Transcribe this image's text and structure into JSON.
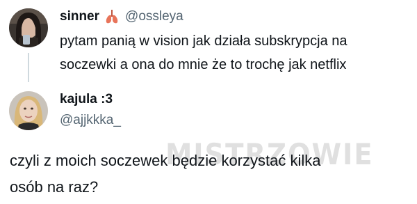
{
  "tweet1": {
    "display_name": "sinner",
    "emoji_icon": "lungs-icon",
    "handle": "@ossleya",
    "text_line1": "pytam panią w vision jak działa subskrypcja na",
    "text_line2": "soczewki a ona do mnie że to trochę jak netflix"
  },
  "tweet2": {
    "display_name": "kajula :3",
    "handle": "@ajjkkka_",
    "text_line1": "czyli z moich soczewek będzie korzystać kilka",
    "text_line2": "osób na raz?"
  },
  "watermark": {
    "text": "MISTRZOWIE"
  },
  "colors": {
    "text_primary": "#0f1419",
    "text_secondary": "#536471",
    "thread_line": "#cfd9de"
  }
}
